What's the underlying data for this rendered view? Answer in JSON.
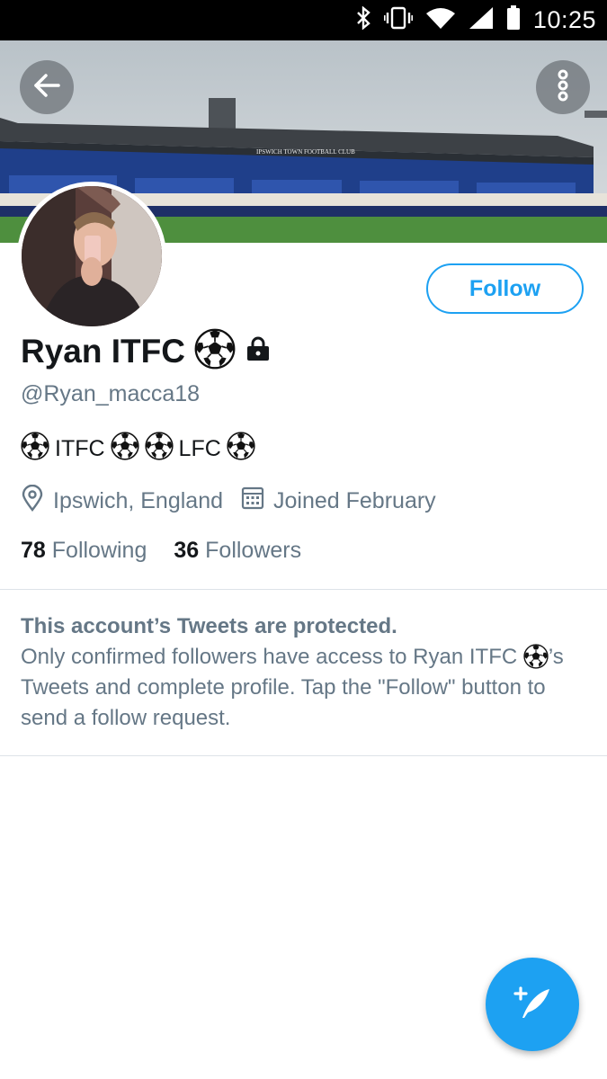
{
  "status_bar": {
    "time": "10:25"
  },
  "profile": {
    "display_name": "Ryan ITFC",
    "handle": "@Ryan_macca18",
    "bio_part1": "ITFC",
    "bio_part2": "LFC",
    "location": "Ipswich, England",
    "joined": "Joined February",
    "following_count": "78",
    "following_label": "Following",
    "followers_count": "36",
    "followers_label": "Followers",
    "banner_sign": "IPSWICH TOWN FOOTBALL CLUB"
  },
  "actions": {
    "follow_label": "Follow"
  },
  "protected_notice": {
    "title": "This account’s Tweets are protected.",
    "body_part1": "Only confirmed followers have access to Ryan ITFC",
    "body_part2": "’s Tweets and complete profile. Tap the \"Follow\" button to send a follow request."
  },
  "icons": {
    "back": "back-arrow-icon",
    "overflow": "more-vertical-icon",
    "lock": "lock-icon",
    "location": "location-pin-icon",
    "calendar": "calendar-icon",
    "compose": "compose-tweet-icon",
    "soccer": "soccer-ball-icon"
  },
  "colors": {
    "accent": "#1da1f2",
    "secondary_text": "#657786",
    "primary_text": "#14171a"
  }
}
